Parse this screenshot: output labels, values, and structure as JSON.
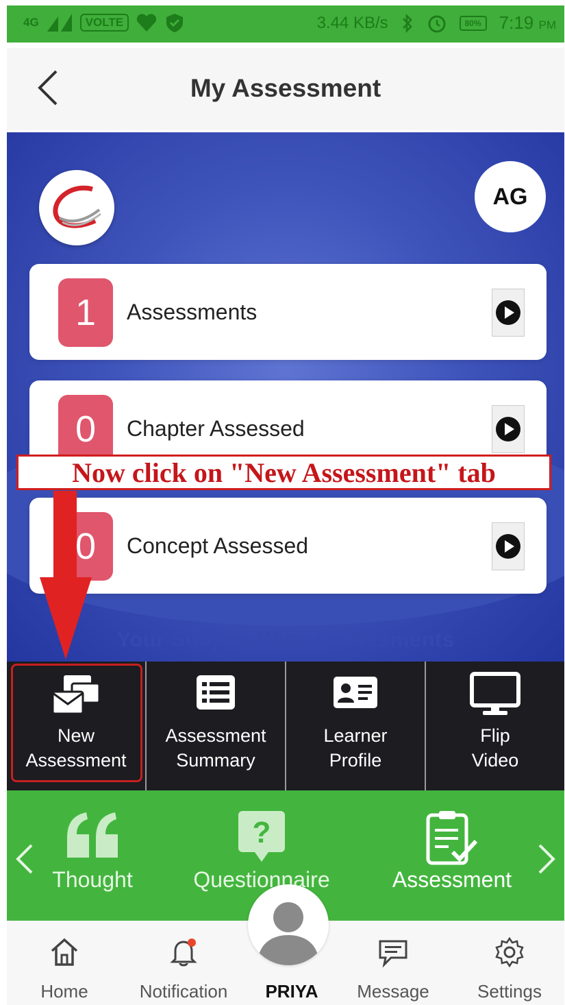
{
  "status_bar": {
    "network": "4G",
    "volte": "VOLTE",
    "speed": "3.44 KB/s",
    "battery": "80%",
    "time": "7:19",
    "ampm": "PM"
  },
  "header": {
    "title": "My Assessment"
  },
  "profile": {
    "initials": "AG"
  },
  "cards": [
    {
      "count": "1",
      "label": "Assessments"
    },
    {
      "count": "0",
      "label": "Chapter Assessed"
    },
    {
      "count": "0",
      "label": "Concept Assessed"
    }
  ],
  "subject_heading": "Your Subject-Wise Assessments",
  "annotation": "Now click on \"New Assessment\" tab",
  "tabs": [
    {
      "line1": "New",
      "line2": "Assessment"
    },
    {
      "line1": "Assessment",
      "line2": "Summary"
    },
    {
      "line1": "Learner",
      "line2": "Profile"
    },
    {
      "line1": "Flip",
      "line2": "Video"
    }
  ],
  "carousel": [
    {
      "label": "Thought"
    },
    {
      "label": "Questionnaire"
    },
    {
      "label": "Assessment"
    }
  ],
  "bottom_nav": [
    {
      "label": "Home"
    },
    {
      "label": "Notification"
    },
    {
      "label": "PRIYA"
    },
    {
      "label": "Message"
    },
    {
      "label": "Settings"
    }
  ],
  "colors": {
    "status_green": "#3fae3a",
    "hero_blue": "#3f54bb",
    "badge_pink": "#e0566d",
    "tab_dark": "#1c1c21",
    "carousel_green": "#43b53e",
    "annotation_red": "#c5161a"
  }
}
